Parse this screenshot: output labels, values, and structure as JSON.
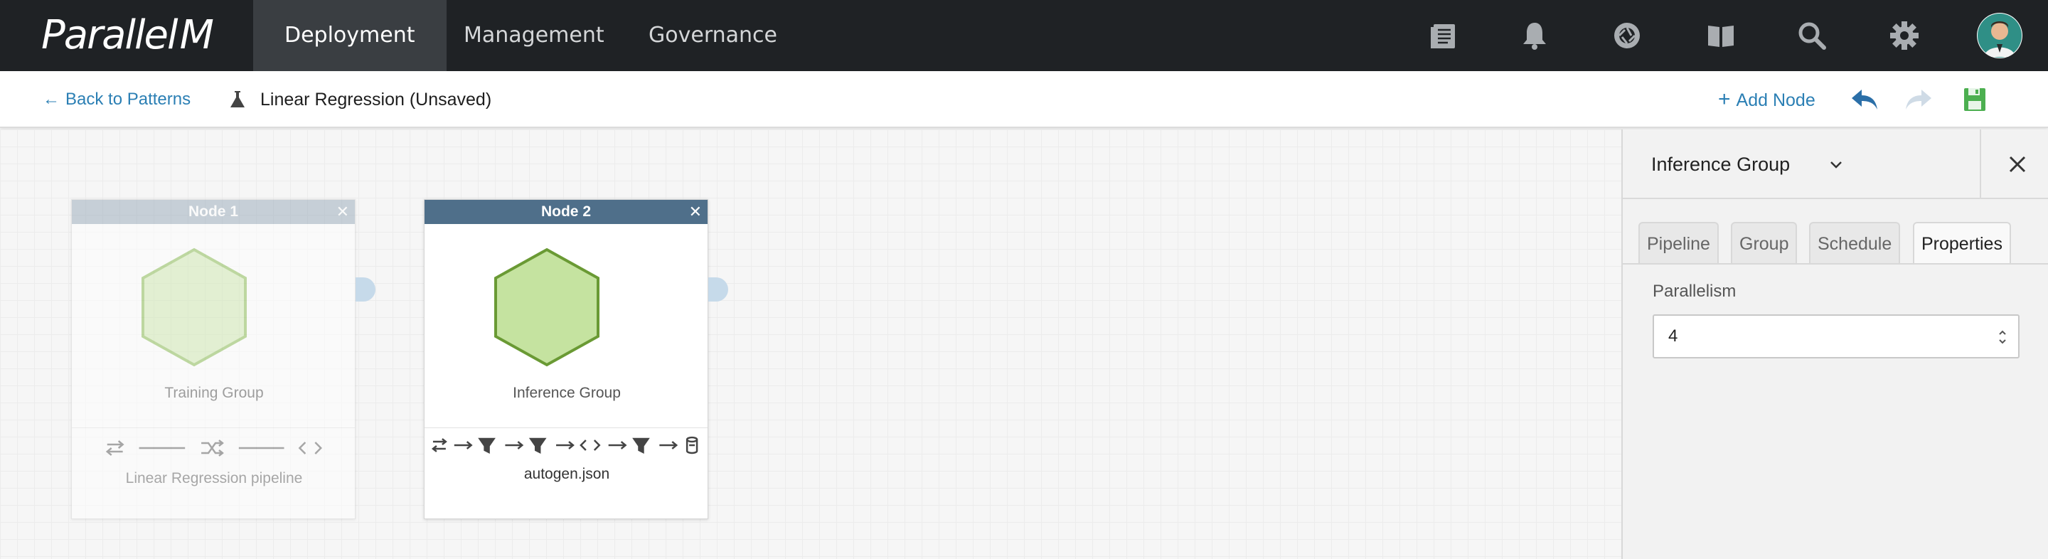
{
  "brand": {
    "logo_text": "Parallel",
    "logo_mark": "M"
  },
  "nav": {
    "tabs": [
      {
        "label": "Deployment",
        "active": true
      },
      {
        "label": "Management",
        "active": false
      },
      {
        "label": "Governance",
        "active": false
      }
    ],
    "icons": [
      "document-list-icon",
      "bell-icon",
      "aperture-icon",
      "book-icon",
      "search-icon",
      "gear-icon"
    ]
  },
  "subbar": {
    "back_label": "Back to Patterns",
    "title": "Linear Regression (Unsaved)",
    "add_node_label": "Add Node",
    "icons": [
      "flask-icon",
      "undo-icon",
      "redo-icon",
      "save-icon"
    ]
  },
  "nodes": [
    {
      "header": "Node 1",
      "group": "Training Group",
      "pipeline": "Linear Regression pipeline",
      "state": "dimmed"
    },
    {
      "header": "Node 2",
      "group": "Inference Group",
      "pipeline": "autogen.json",
      "state": "active"
    }
  ],
  "panel": {
    "title": "Inference Group",
    "tabs": [
      "Pipeline",
      "Group",
      "Schedule",
      "Properties"
    ],
    "active_tab": "Properties",
    "field_label": "Parallelism",
    "field_value": "4"
  },
  "colors": {
    "topbar": "#1f2225",
    "link": "#2b7fb4",
    "node_header_active": "#4f6f8a",
    "node_header_dim": "#9fb0be",
    "hex_fill": "#c5e3a0",
    "hex_stroke": "#6a9a34",
    "save_green": "#4caf50"
  }
}
